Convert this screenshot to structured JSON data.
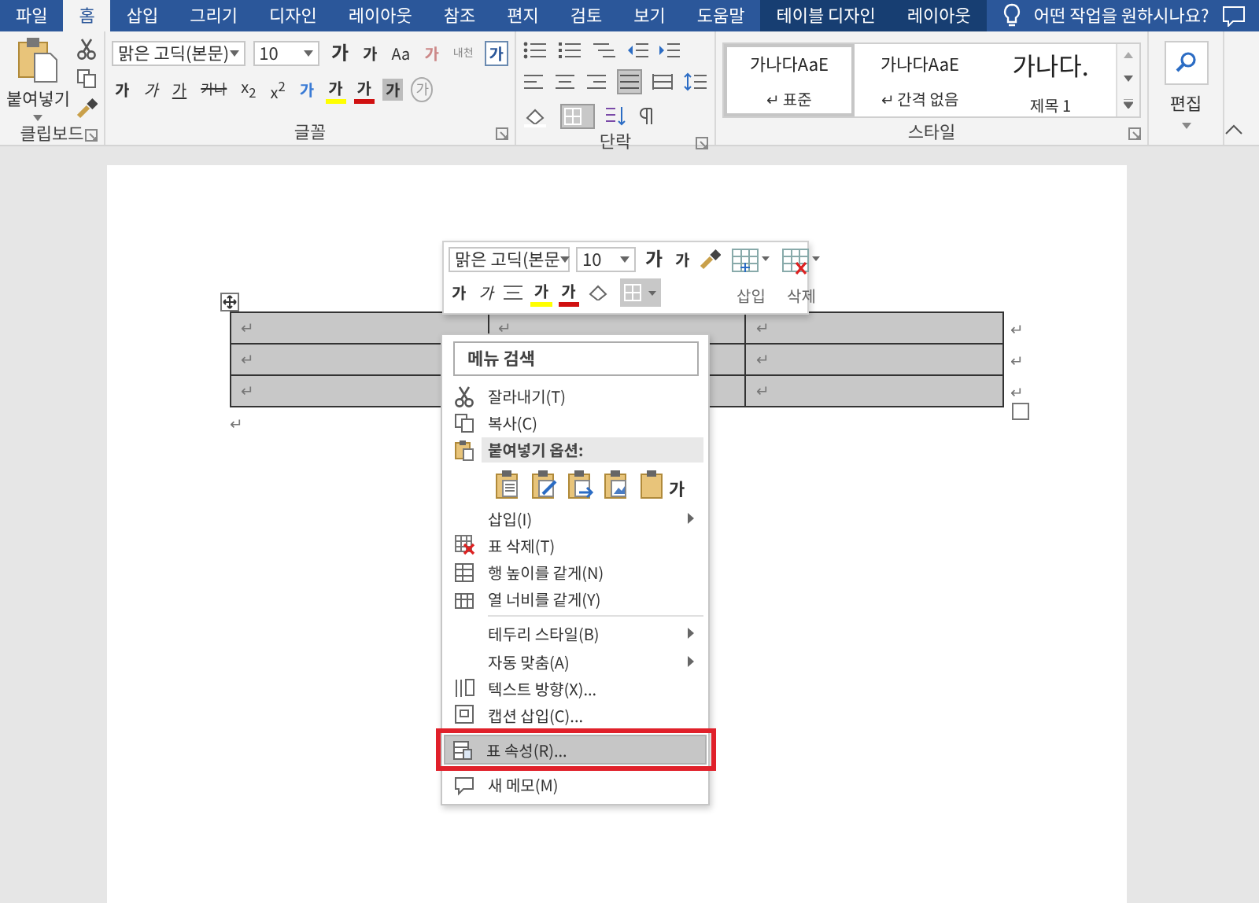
{
  "tabs": [
    {
      "label": "파일",
      "selected": false,
      "contextual": false
    },
    {
      "label": "홈",
      "selected": true,
      "contextual": false
    },
    {
      "label": "삽입",
      "selected": false,
      "contextual": false
    },
    {
      "label": "그리기",
      "selected": false,
      "contextual": false
    },
    {
      "label": "디자인",
      "selected": false,
      "contextual": false
    },
    {
      "label": "레이아웃",
      "selected": false,
      "contextual": false
    },
    {
      "label": "참조",
      "selected": false,
      "contextual": false
    },
    {
      "label": "편지",
      "selected": false,
      "contextual": false
    },
    {
      "label": "검토",
      "selected": false,
      "contextual": false
    },
    {
      "label": "보기",
      "selected": false,
      "contextual": false
    },
    {
      "label": "도움말",
      "selected": false,
      "contextual": false
    },
    {
      "label": "테이블 디자인",
      "selected": false,
      "contextual": true
    },
    {
      "label": "레이아웃",
      "selected": false,
      "contextual": true
    }
  ],
  "tell_me": "어떤 작업을 원하시나요?",
  "ribbon": {
    "clipboard": {
      "paste_label": "붙여넣기",
      "group_label": "클립보드"
    },
    "font": {
      "name": "맑은 고딕(본문)",
      "size": "10",
      "group_label": "글꼴",
      "row1": [
        {
          "text": "가",
          "kind": "grow"
        },
        {
          "text": "가",
          "kind": "shrink"
        },
        {
          "text": "Aa",
          "kind": "case"
        },
        {
          "text": "가",
          "kind": "clear"
        },
        {
          "text": "내천",
          "kind": "phonetic"
        },
        {
          "text": "가",
          "kind": "boxed"
        }
      ],
      "row2": [
        {
          "text": "가",
          "kind": "bold"
        },
        {
          "text": "가",
          "kind": "italic"
        },
        {
          "text": "가",
          "kind": "underline"
        },
        {
          "text": "가나",
          "kind": "strike"
        },
        {
          "text": "x$_{2}$",
          "kind": "plain"
        },
        {
          "text": "x$^{2}$",
          "kind": "plain"
        },
        {
          "text": "가",
          "kind": "effect"
        },
        {
          "text": "가",
          "kind": "highlight"
        },
        {
          "text": "가",
          "kind": "color"
        },
        {
          "text": "가",
          "kind": "shade"
        },
        {
          "text": "가",
          "kind": "circled"
        }
      ]
    },
    "paragraph": {
      "group_label": "단락"
    },
    "styles": {
      "group_label": "스타일",
      "items": [
        {
          "sample": "가나다AaE",
          "name": "↵ 표준",
          "selected": true,
          "kind": "body"
        },
        {
          "sample": "가나다AaE",
          "name": "↵ 간격 없음",
          "selected": false,
          "kind": "body"
        },
        {
          "sample": "가나다.",
          "name": "제목 1",
          "selected": false,
          "kind": "heading"
        }
      ]
    },
    "editing": {
      "label": "편집"
    }
  },
  "table": {
    "rows": [
      [
        "↵",
        "↵",
        "↵"
      ],
      [
        "↵",
        null,
        "↵"
      ],
      [
        "↵",
        null,
        "↵"
      ]
    ],
    "row_end_mark": "↵"
  },
  "after_table_mark": "↵",
  "mini_toolbar": {
    "font": "맑은 고딕(본문",
    "size": "10",
    "grow": "가",
    "shrink": "가",
    "row2": [
      {
        "text": "가",
        "kind": "bold"
      },
      {
        "text": "가",
        "kind": "italic"
      },
      {
        "text": "가",
        "kind": "highlight"
      },
      {
        "text": "가",
        "kind": "color"
      }
    ],
    "insert_label": "삽입",
    "delete_label": "삭제"
  },
  "context_menu": {
    "search_placeholder": "메뉴 검색",
    "items": [
      {
        "label": "잘라내기(T)",
        "kind": "item",
        "selected": false
      },
      {
        "label": "복사(C)",
        "kind": "item",
        "selected": false
      },
      {
        "label": "붙여넣기 옵션:",
        "kind": "header"
      },
      {
        "label": "가",
        "kind": "paste-options"
      },
      {
        "label": "삽입(I)",
        "kind": "submenu",
        "selected": false
      },
      {
        "label": "표 삭제(T)",
        "kind": "item",
        "selected": false
      },
      {
        "label": "행 높이를 같게(N)",
        "kind": "item",
        "selected": false
      },
      {
        "label": "열 너비를 같게(Y)",
        "kind": "item",
        "selected": false
      },
      {
        "kind": "separator"
      },
      {
        "label": "테두리 스타일(B)",
        "kind": "submenu",
        "selected": false
      },
      {
        "label": "자동 맞춤(A)",
        "kind": "submenu",
        "selected": false
      },
      {
        "label": "텍스트 방향(X)...",
        "kind": "item",
        "selected": false
      },
      {
        "label": "캡션 삽입(C)...",
        "kind": "item",
        "selected": false
      },
      {
        "label": "표 속성(R)...",
        "kind": "item",
        "selected": true
      },
      {
        "label": "새 메모(M)",
        "kind": "item",
        "selected": false
      }
    ],
    "highlight_box": true
  }
}
